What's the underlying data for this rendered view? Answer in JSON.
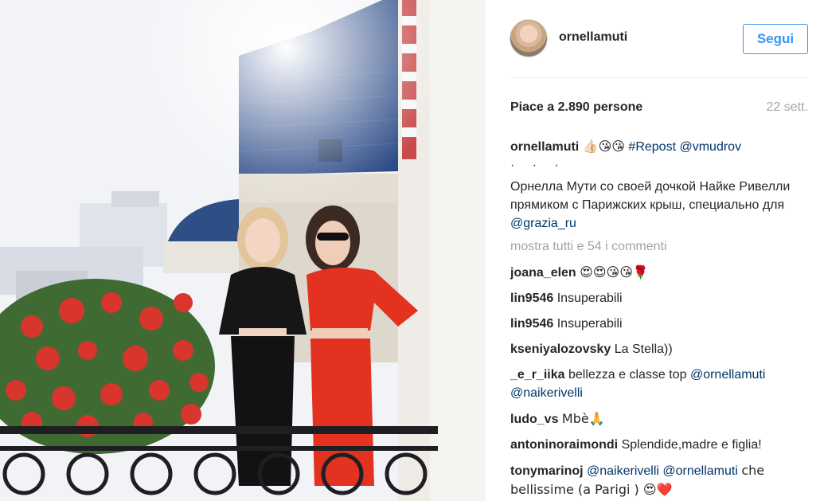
{
  "post": {
    "username": "ornellamuti",
    "follow_label": "Segui",
    "likes_text": "Piace a 2.890 persone",
    "time_text": "22 sett."
  },
  "caption": {
    "user": "ornellamuti",
    "emojis": "👍🏻😘😘",
    "hashtag": "#Repost",
    "mention": "@vmudrov",
    "dots": "· · ·",
    "body": "Орнелла Мути со своей дочкой Найке Ривелли прямиком с Парижских крыш, специально для",
    "body_mention": "@grazia_ru"
  },
  "more_comments": "mostra tutti e 54 i commenti",
  "comments": [
    {
      "user": "joana_elen",
      "text": "😍😍😘😘🌹"
    },
    {
      "user": "lin9546",
      "text": "Insuperabili"
    },
    {
      "user": "lin9546",
      "text": "Insuperabili"
    },
    {
      "user": "kseniyalozovsky",
      "text": "La Stella))"
    },
    {
      "user": "_e_r_iika",
      "text": "bellezza e classe top",
      "mentions": "@ornellamuti @naikerivelli"
    },
    {
      "user": "ludo_vs",
      "text": "Mbè🙏"
    },
    {
      "user": "antoninoraimondi",
      "text": "Splendide,madre e figlia!"
    },
    {
      "user": "tonymarinoj",
      "mentions": "@naikerivelli @ornellamuti",
      "text": "che bellissime (a Parigi ) 😍❤️"
    }
  ],
  "icons": {
    "avatar": "profile-avatar",
    "photo": "post-photo"
  }
}
